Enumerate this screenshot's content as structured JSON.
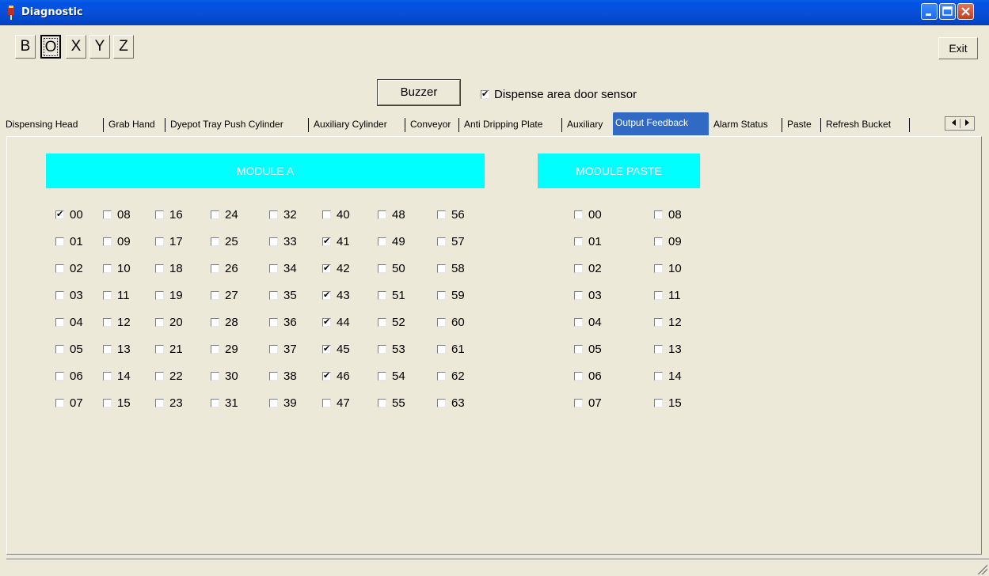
{
  "window": {
    "title": "Diagnostic"
  },
  "toolbar": {
    "buttons": [
      "B",
      "O",
      "X",
      "Y",
      "Z"
    ],
    "active_button": "O",
    "exit_label": "Exit"
  },
  "controls": {
    "buzzer_label": "Buzzer",
    "door_sensor_label": "Dispense area door sensor",
    "door_sensor_checked": true
  },
  "tabs": [
    "Dispensing Head",
    "Grab Hand",
    "Dyepot Tray Push Cylinder",
    "Auxiliary Cylinder",
    "Conveyor",
    "Anti Dripping Plate",
    "Auxiliary",
    "Output Feedback",
    "Alarm Status",
    "Paste",
    "Refresh Bucket"
  ],
  "selected_tab": "Output Feedback",
  "module_a": {
    "title": "MODULE A",
    "items": [
      "00",
      "01",
      "02",
      "03",
      "04",
      "05",
      "06",
      "07",
      "08",
      "09",
      "10",
      "11",
      "12",
      "13",
      "14",
      "15",
      "16",
      "17",
      "18",
      "19",
      "20",
      "21",
      "22",
      "23",
      "24",
      "25",
      "26",
      "27",
      "28",
      "29",
      "30",
      "31",
      "32",
      "33",
      "34",
      "35",
      "36",
      "37",
      "38",
      "39",
      "40",
      "41",
      "42",
      "43",
      "44",
      "45",
      "46",
      "47",
      "48",
      "49",
      "50",
      "51",
      "52",
      "53",
      "54",
      "55",
      "56",
      "57",
      "58",
      "59",
      "60",
      "61",
      "62",
      "63"
    ],
    "checked": [
      "00",
      "41",
      "42",
      "43",
      "44",
      "45",
      "46"
    ]
  },
  "module_paste": {
    "title": "MODULE PASTE",
    "items": [
      "00",
      "01",
      "02",
      "03",
      "04",
      "05",
      "06",
      "07",
      "08",
      "09",
      "10",
      "11",
      "12",
      "13",
      "14",
      "15"
    ],
    "checked": []
  },
  "colors": {
    "module_header": "#00ffff",
    "selected_tab": "#316ac5",
    "window_bg": "#ece9d8"
  }
}
